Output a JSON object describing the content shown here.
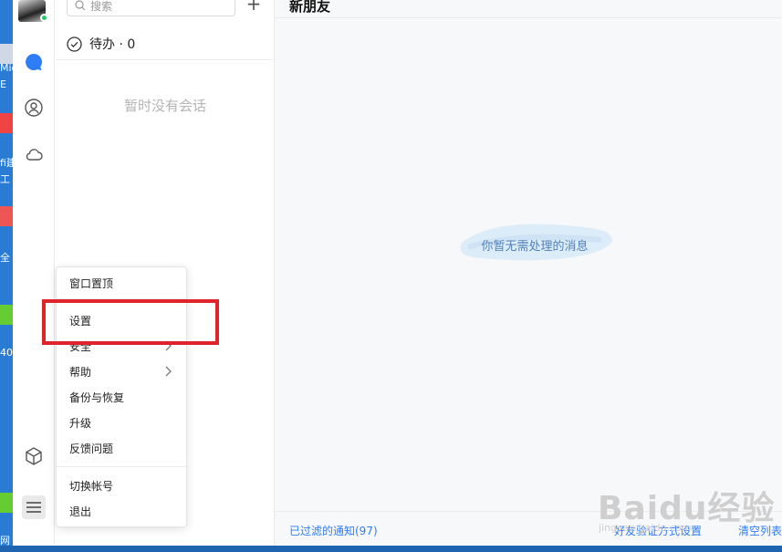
{
  "desktop": {
    "label_1": "Mic",
    "label_2": "E",
    "label_3": "fi建",
    "label_4": "工",
    "label_5": "全",
    "label_6": "40",
    "label_7": "网"
  },
  "search": {
    "placeholder": "搜索"
  },
  "todo": {
    "label": "待办 · 0"
  },
  "list": {
    "empty_text": "暂时没有会话"
  },
  "main": {
    "title": "新朋友",
    "empty_text": "你暂无需处理的消息",
    "footer_left": "已过滤的通知(97)",
    "footer_mid": "好友验证方式设置",
    "footer_right": "清空列表"
  },
  "menu": {
    "items": [
      "窗口置顶",
      "设置",
      "安全",
      "帮助",
      "备份与恢复",
      "升级",
      "反馈问题",
      "切换帐号",
      "退出"
    ]
  },
  "watermark": {
    "text": "Baidu经验",
    "sub": "jingyan.baidu.com"
  },
  "icons": [
    "avatar",
    "chat-bubble-icon",
    "contacts-icon",
    "cloud-icon",
    "cube-icon",
    "menu-icon",
    "search-icon",
    "plus-icon",
    "check-circle-icon",
    "chevron-right-icon"
  ],
  "colors": {
    "accent": "#2e7cf6",
    "highlight": "#e0242b",
    "presence": "#2bc66b"
  }
}
